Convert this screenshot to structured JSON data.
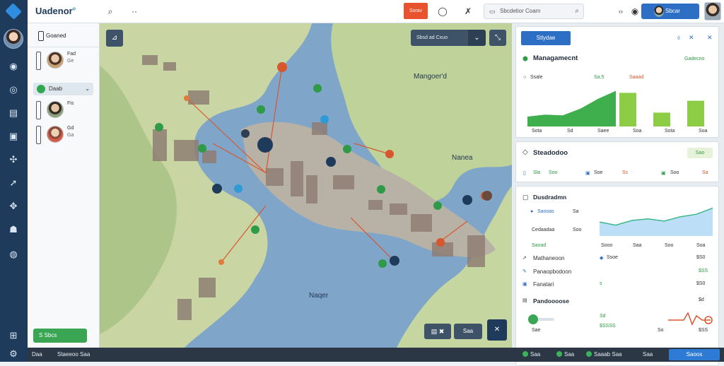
{
  "brand": {
    "name": "Uadenor",
    "mark": "o"
  },
  "topbar": {
    "red_button": "Ssrav",
    "search_text": "Sbcdetior Coam",
    "user_label": "Sbcar"
  },
  "left_panel": {
    "header": "Goaned",
    "contacts": [
      {
        "name": "Fad",
        "sub": "Ge"
      },
      {
        "name": "Fis",
        "sub": ""
      },
      {
        "name": "Gd",
        "sub": "Ga"
      }
    ],
    "chip": "Daab",
    "green_button": "S Sbcs"
  },
  "map": {
    "search_label": "Sbsd ad Cxuo",
    "labels": [
      "Mangoer'd",
      "Nanea",
      "Naqer"
    ],
    "bottom_button": "Saa"
  },
  "cards": {
    "header_tab": "Stlydae",
    "management": {
      "title": "Managamecnt",
      "badge": "Gadecno",
      "legend": [
        "Ssale",
        "Sa.5",
        "Saaad"
      ],
      "axis": [
        "Sota",
        "Sd",
        "Saee",
        "Soa",
        "Sota",
        "Soa"
      ],
      "series": [
        0.25,
        0.3,
        0.28,
        0.45,
        0.7,
        0.9
      ],
      "bars": [
        0.85,
        0.35,
        0.65
      ],
      "colors": {
        "area": "#3fae4c",
        "bar": "#8ccd45",
        "accent": "#2e6fc6"
      }
    },
    "stats": {
      "title": "Steadodoo",
      "badge": "Sao",
      "items": [
        "Sla",
        "Soo",
        "Soe",
        "Ss",
        "Soo",
        "Sa"
      ]
    },
    "overview": {
      "title": "Dusdradmn",
      "rows": [
        {
          "label": "Saooas",
          "value": "Sa"
        },
        {
          "label": "Cedaadaa",
          "value": "Soo"
        }
      ],
      "axis": [
        "Sooo",
        "Saa",
        "Soo",
        "Soa"
      ],
      "series": [
        0.45,
        0.35,
        0.5,
        0.55,
        0.48,
        0.62,
        0.7,
        0.9
      ],
      "footer": "Saoad"
    },
    "list": [
      {
        "label": "Mathaneoon",
        "mid": "Ssoe",
        "value": "$S0"
      },
      {
        "label": "Panaopbodoon",
        "mid": "",
        "value": "$SS"
      },
      {
        "label": "Fanatari",
        "mid": "s",
        "value": "$S0"
      }
    ],
    "bottom": {
      "title": "Pandoooose",
      "mid_top": "Sd",
      "mid_bottom": "$SSSS",
      "right_top": "$d",
      "axis": [
        "Sae",
        "So",
        "$SS"
      ],
      "progress": 0.3
    }
  },
  "statusbar": {
    "items": [
      "Daa",
      "Staeeoo Saa",
      "Saa",
      "Saa",
      "Saaab Saa",
      "Saa"
    ],
    "button": "Saoos"
  }
}
